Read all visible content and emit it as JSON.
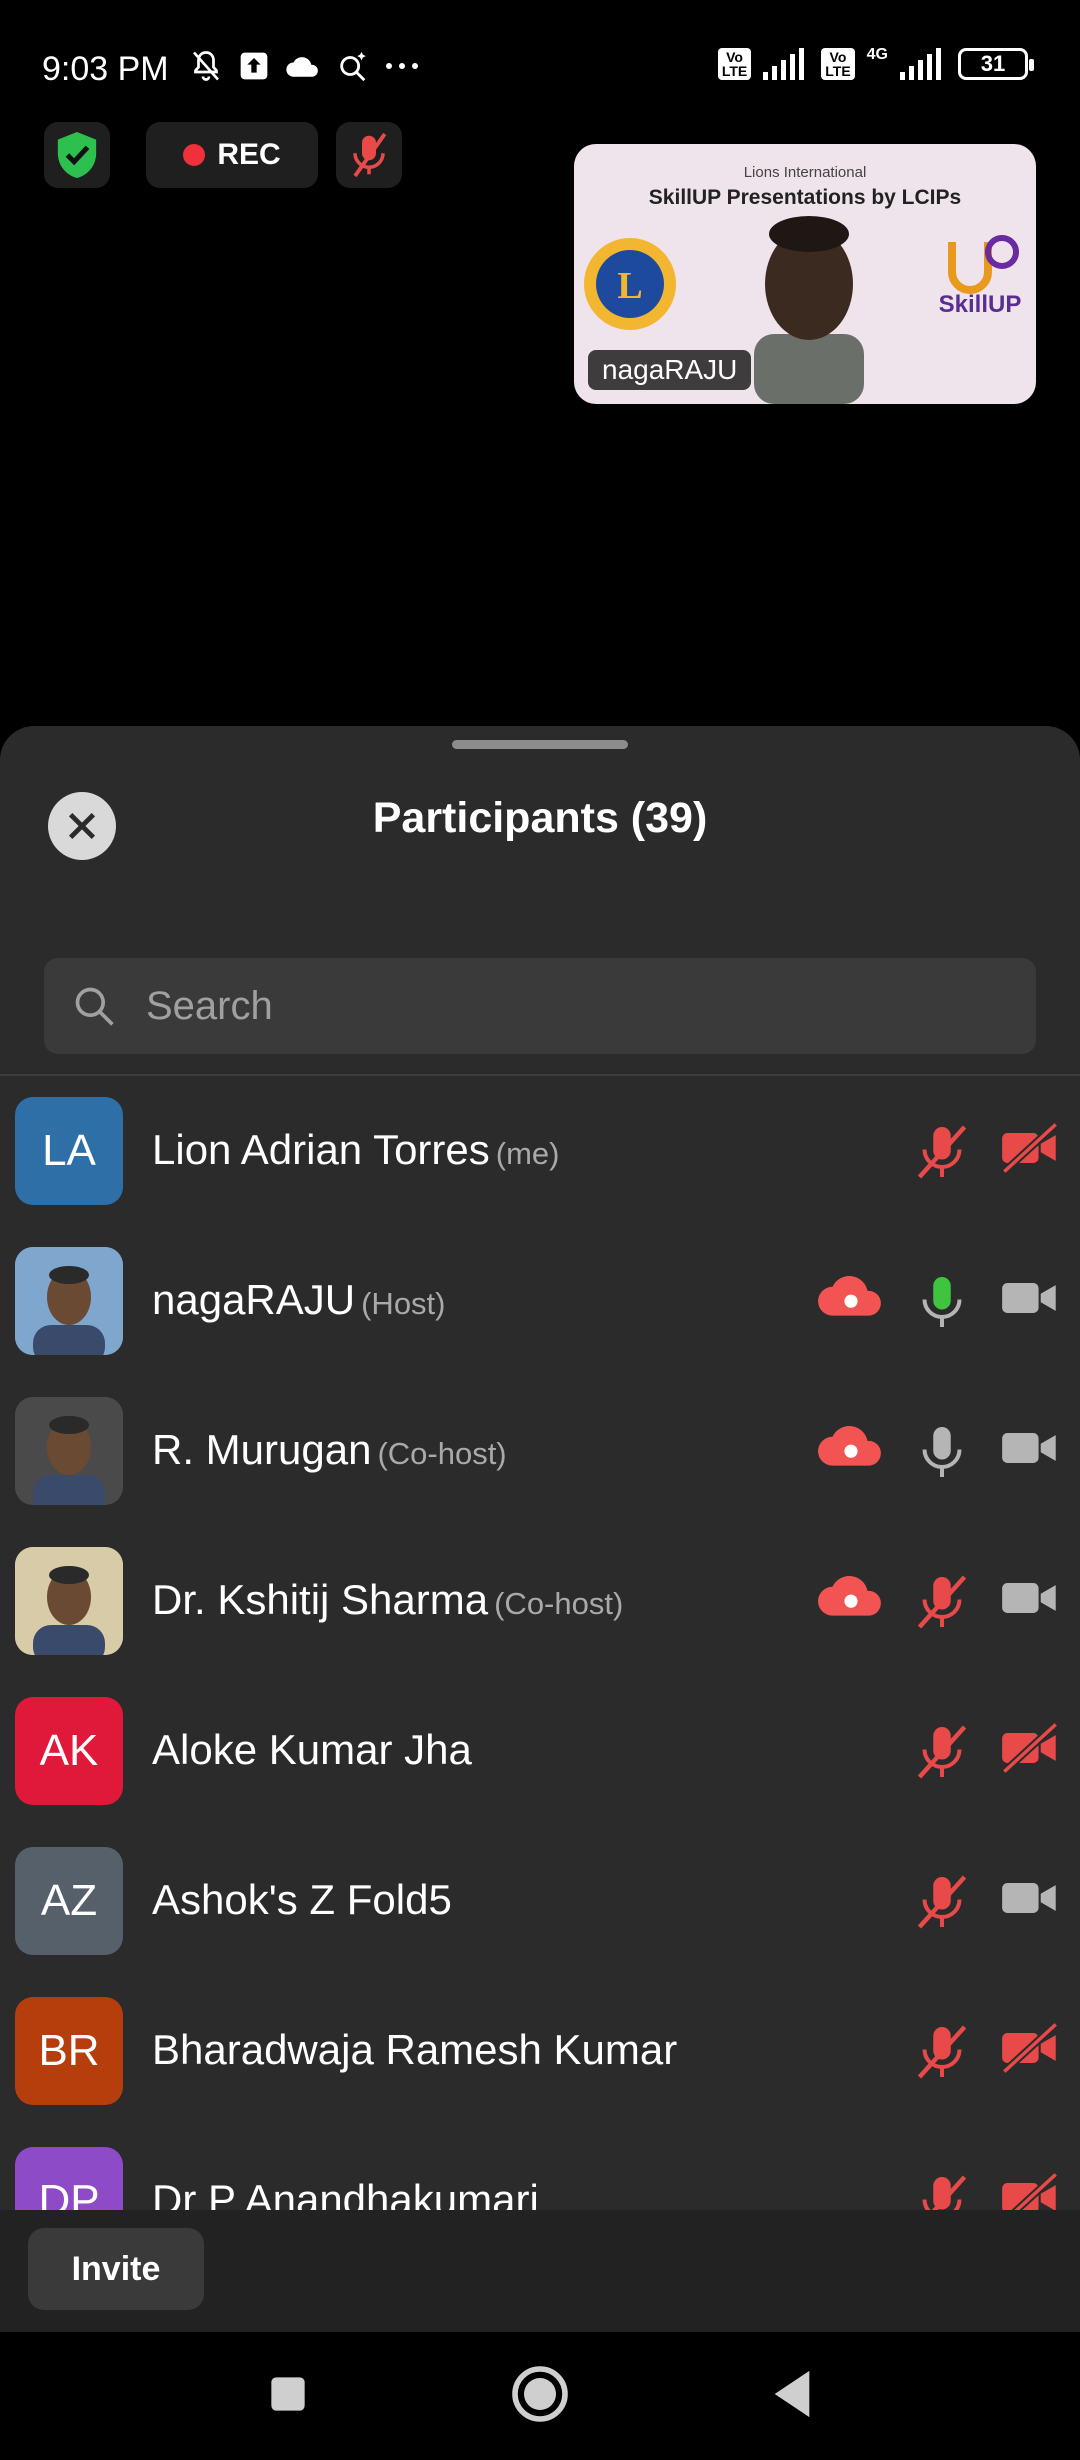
{
  "status_bar": {
    "time": "9:03 PM",
    "network_4g": "4G",
    "lte_label": "Vo LTE",
    "battery": "31"
  },
  "meeting": {
    "rec_label": "REC",
    "colors": {
      "shield": "#2ec04f",
      "rec": "#f0303a",
      "muted": "#e84a4a",
      "unmuted_mic": "#3ec43e"
    }
  },
  "video_tile": {
    "name": "nagaRAJU",
    "slide_org": "Lions International",
    "slide_title": "SkillUP Presentations by LCIPs",
    "skillup_text": "SkillUP"
  },
  "sheet": {
    "title": "Participants (39)",
    "search_placeholder": "Search",
    "invite_label": "Invite"
  },
  "participants": [
    {
      "name": "Lion Adrian Torres",
      "role": "(me)",
      "initials": "LA",
      "color": "#2e6fa8",
      "cloud": false,
      "mic": "muted",
      "cam": "off"
    },
    {
      "name": "nagaRAJU",
      "role": "(Host)",
      "initials": "",
      "color": "#7fa6cc",
      "cloud": true,
      "mic": "active",
      "cam": "on"
    },
    {
      "name": "R. Murugan",
      "role": "(Co-host)",
      "initials": "",
      "color": "#4a4a4a",
      "cloud": true,
      "mic": "on",
      "cam": "on"
    },
    {
      "name": "Dr. Kshitij Sharma",
      "role": "(Co-host)",
      "initials": "",
      "color": "#d8cba8",
      "cloud": true,
      "mic": "muted",
      "cam": "on"
    },
    {
      "name": "Aloke Kumar Jha",
      "role": "",
      "initials": "AK",
      "color": "#e0183a",
      "cloud": false,
      "mic": "muted",
      "cam": "off"
    },
    {
      "name": "Ashok's Z Fold5",
      "role": "",
      "initials": "AZ",
      "color": "#56606b",
      "cloud": false,
      "mic": "muted",
      "cam": "on"
    },
    {
      "name": "Bharadwaja Ramesh Kumar",
      "role": "",
      "initials": "BR",
      "color": "#b63d0c",
      "cloud": false,
      "mic": "muted",
      "cam": "off"
    },
    {
      "name": "Dr P Anandhakumari",
      "role": "",
      "initials": "DP",
      "color": "#8e4bc7",
      "cloud": false,
      "mic": "muted",
      "cam": "off"
    }
  ]
}
